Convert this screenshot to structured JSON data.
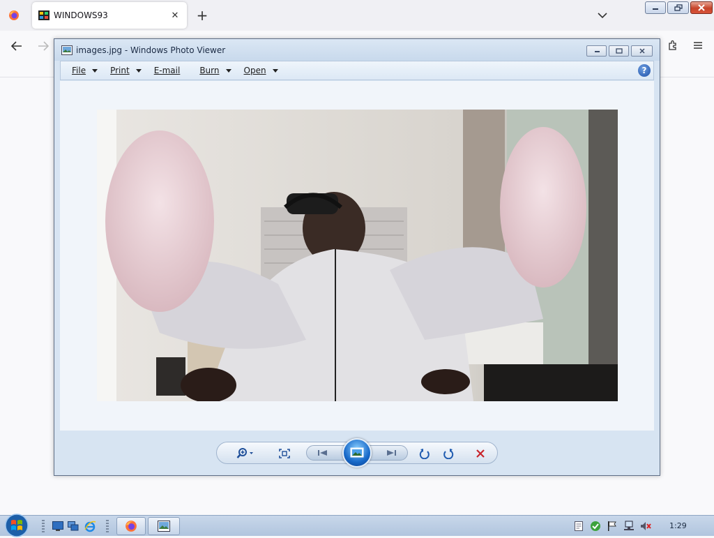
{
  "browser": {
    "tab_title": "WINDOWS93",
    "close_glyph": "✕",
    "new_tab_glyph": "+",
    "colors": {
      "accent": "#ff7139",
      "close_red": "#c6452a"
    }
  },
  "viewer": {
    "title": "images.jpg - Windows Photo Viewer",
    "menu": [
      {
        "label": "File",
        "has_arrow": true
      },
      {
        "label": "Print",
        "has_arrow": true
      },
      {
        "label": "E-mail",
        "has_arrow": false
      },
      {
        "label": "Burn",
        "has_arrow": true
      },
      {
        "label": "Open",
        "has_arrow": true
      }
    ],
    "help_glyph": "?",
    "image_name": "images.jpg",
    "toolbar_icons": [
      "zoom-icon",
      "actual-size-icon",
      "previous-icon",
      "slideshow-icon",
      "next-icon",
      "rotate-left-icon",
      "rotate-right-icon",
      "delete-icon"
    ]
  },
  "taskbar": {
    "clock": "1:29",
    "quick_launch": [
      "show-desktop-icon",
      "switch-windows-icon",
      "internet-explorer-icon"
    ],
    "buttons": [
      "firefox-task-icon",
      "photo-viewer-task-icon"
    ],
    "tray": [
      "action-center-icon",
      "security-icon",
      "flag-icon",
      "network-icon",
      "volume-muted-icon"
    ]
  }
}
